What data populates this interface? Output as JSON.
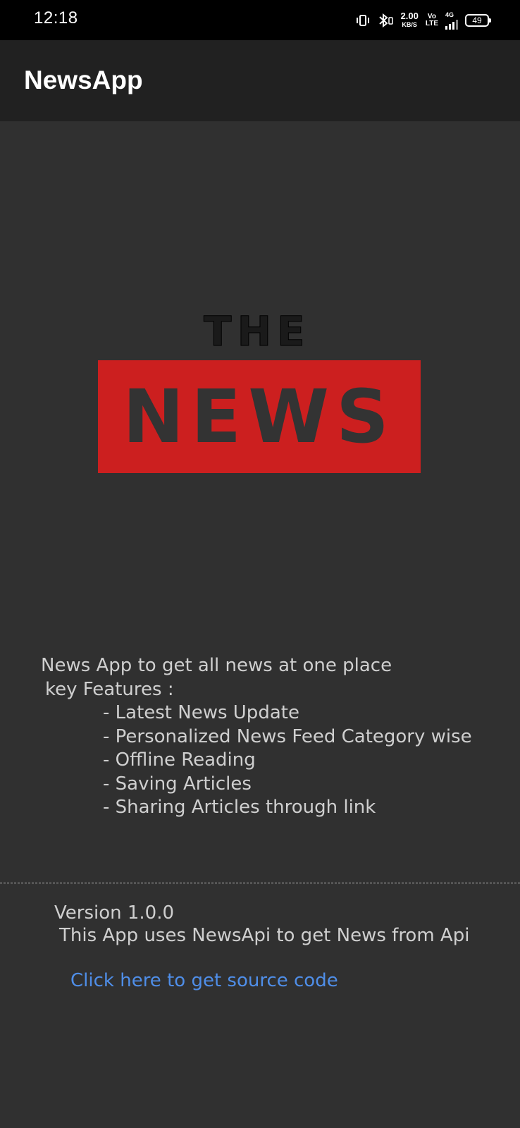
{
  "status_bar": {
    "time": "12:18",
    "speed_value": "2.00",
    "speed_unit": "KB/S",
    "volte_top": "Vo",
    "volte_bottom": "LTE",
    "network": "4G",
    "battery": "49",
    "icons": [
      "vibrate-icon",
      "bluetooth-icon",
      "signal-icon",
      "battery-icon"
    ]
  },
  "app_bar": {
    "title": "NewsApp"
  },
  "logo": {
    "line1": "THE",
    "line2": "NEWS",
    "accent_color": "#cc1f1f"
  },
  "description": {
    "intro": "News App to get all news at one place",
    "features_heading": "key Features :",
    "features": [
      "- Latest News Update",
      "- Personalized News Feed Category wise",
      "- Offline Reading",
      "- Saving Articles",
      "- Sharing Articles through link"
    ]
  },
  "footer": {
    "version": "Version 1.0.0",
    "api_note": "This App uses NewsApi to get News from Api",
    "source_link": "Click here to get source code",
    "link_color": "#4f8ee8"
  }
}
